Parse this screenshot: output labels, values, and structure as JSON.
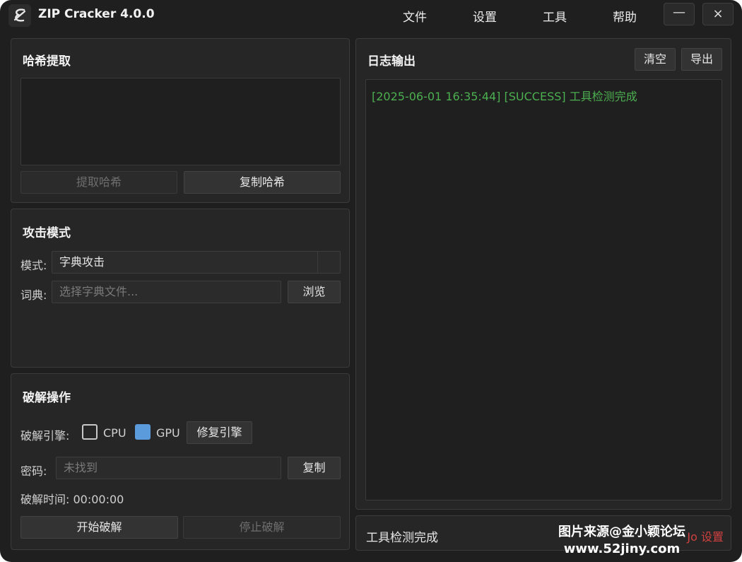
{
  "app": {
    "title": "ZIP Cracker 4.0.0",
    "logo_glyph": "ℰ"
  },
  "menu": [
    "文件",
    "设置",
    "工具",
    "帮助"
  ],
  "window_controls": {
    "minimize": "—",
    "close": "×"
  },
  "hash_panel": {
    "title": "哈希提取",
    "textarea_value": "",
    "extract_button": "提取哈希",
    "copy_button": "复制哈希"
  },
  "attack_panel": {
    "title": "攻击模式",
    "mode_label": "模式:",
    "mode_value": "字典攻击",
    "dict_label": "词典:",
    "dict_placeholder": "选择字典文件...",
    "browse_button": "浏览"
  },
  "crack_panel": {
    "title": "破解操作",
    "engine_label": "破解引擎:",
    "cpu_label": "CPU",
    "cpu_checked": false,
    "gpu_label": "GPU",
    "gpu_checked": true,
    "repair_button": "修复引擎",
    "password_label": "密码:",
    "password_placeholder": "未找到",
    "copy_button": "复制",
    "time_label": "破解时间: 00:00:00",
    "start_button": "开始破解",
    "stop_button": "停止破解"
  },
  "log_panel": {
    "title": "日志输出",
    "clear_button": "清空",
    "export_button": "导出",
    "lines": [
      "[2025-06-01 16:35:44] [SUCCESS] 工具检测完成"
    ]
  },
  "status_bar": {
    "text": "工具检测完成",
    "right_text": "Jo 设置"
  },
  "watermark": {
    "line1": "图片来源@金小颖论坛",
    "line2": "www.52jiny.com"
  },
  "colors": {
    "background": "#1f1f1f",
    "panel": "#262626",
    "log_success": "#4caf50",
    "gpu_checked": "#5b9bdc"
  }
}
